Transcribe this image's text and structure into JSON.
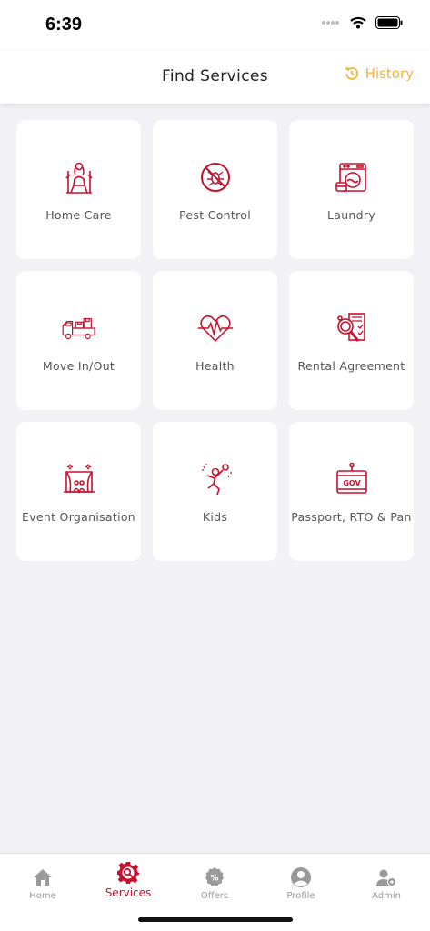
{
  "status_bar": {
    "time": "6:39"
  },
  "header": {
    "title": "Find Services",
    "history_label": "History"
  },
  "services": [
    {
      "label": "Home Care",
      "icon": "home-care-icon"
    },
    {
      "label": "Pest Control",
      "icon": "pest-control-icon"
    },
    {
      "label": "Laundry",
      "icon": "washing-machine-icon"
    },
    {
      "label": "Move In/Out",
      "icon": "moving-truck-icon"
    },
    {
      "label": "Health",
      "icon": "heartbeat-icon"
    },
    {
      "label": "Rental Agreement",
      "icon": "rental-agreement-icon"
    },
    {
      "label": "Event Organisation",
      "icon": "event-stage-icon"
    },
    {
      "label": "Kids",
      "icon": "kids-icon"
    },
    {
      "label": "Passport, RTO & Pan",
      "icon": "gov-document-icon"
    }
  ],
  "gov_icon_text": "GOV",
  "tabbar": {
    "items": [
      {
        "label": "Home",
        "icon": "home-icon"
      },
      {
        "label": "Services",
        "icon": "services-gear-icon",
        "active": true
      },
      {
        "label": "Offers",
        "icon": "offers-icon"
      },
      {
        "label": "Profile",
        "icon": "profile-icon"
      },
      {
        "label": "Admin",
        "icon": "admin-icon"
      }
    ]
  },
  "colors": {
    "accent": "#c8102e",
    "history": "#f4b23f",
    "background": "#f2f2f6"
  }
}
